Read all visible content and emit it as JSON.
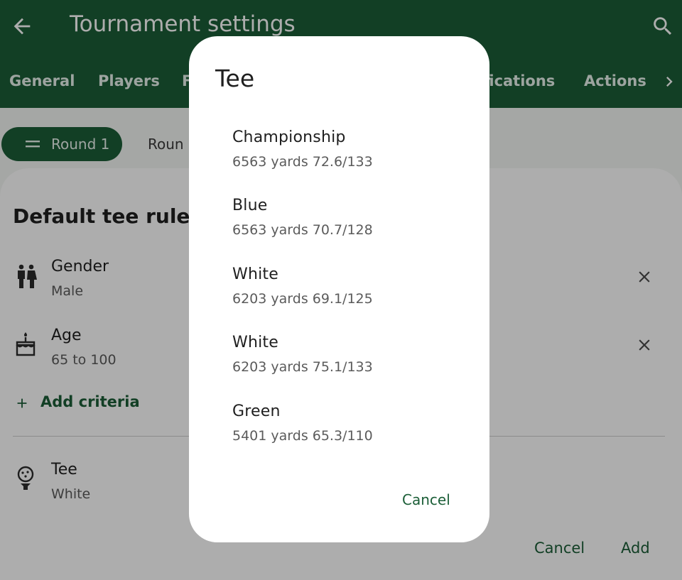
{
  "appbar": {
    "title": "Tournament settings",
    "back_icon": "arrow-back-icon",
    "search_icon": "search-icon",
    "tabs": [
      {
        "label": "General"
      },
      {
        "label": "Players"
      },
      {
        "label": "F"
      },
      {
        "label": "fications"
      },
      {
        "label": "Actions"
      }
    ],
    "more_icon": "chevron-right-icon"
  },
  "rounds": {
    "active_chip": "Round 1",
    "second_chip": "Roun"
  },
  "sheet": {
    "title": "Default tee rule",
    "criteria": [
      {
        "icon": "gender-icon",
        "title": "Gender",
        "value": "Male"
      },
      {
        "icon": "cake-icon",
        "title": "Age",
        "value": "65 to 100"
      }
    ],
    "add_criteria": "Add criteria",
    "tee": {
      "icon": "golf-tee-icon",
      "title": "Tee",
      "value": "White"
    },
    "cancel_label": "Cancel",
    "add_label": "Add"
  },
  "dialog": {
    "title": "Tee",
    "options": [
      {
        "name": "Championship",
        "detail": "6563 yards 72.6/133"
      },
      {
        "name": "Blue",
        "detail": "6563 yards 70.7/128"
      },
      {
        "name": "White",
        "detail": "6203 yards 69.1/125"
      },
      {
        "name": "White",
        "detail": "6203 yards 75.1/133"
      },
      {
        "name": "Green",
        "detail": "5401 yards 65.3/110"
      }
    ],
    "cancel_label": "Cancel"
  },
  "colors": {
    "primary": "#1b5e37",
    "scrim": "rgba(0,0,0,0.32)",
    "surface": "#ffffff"
  }
}
